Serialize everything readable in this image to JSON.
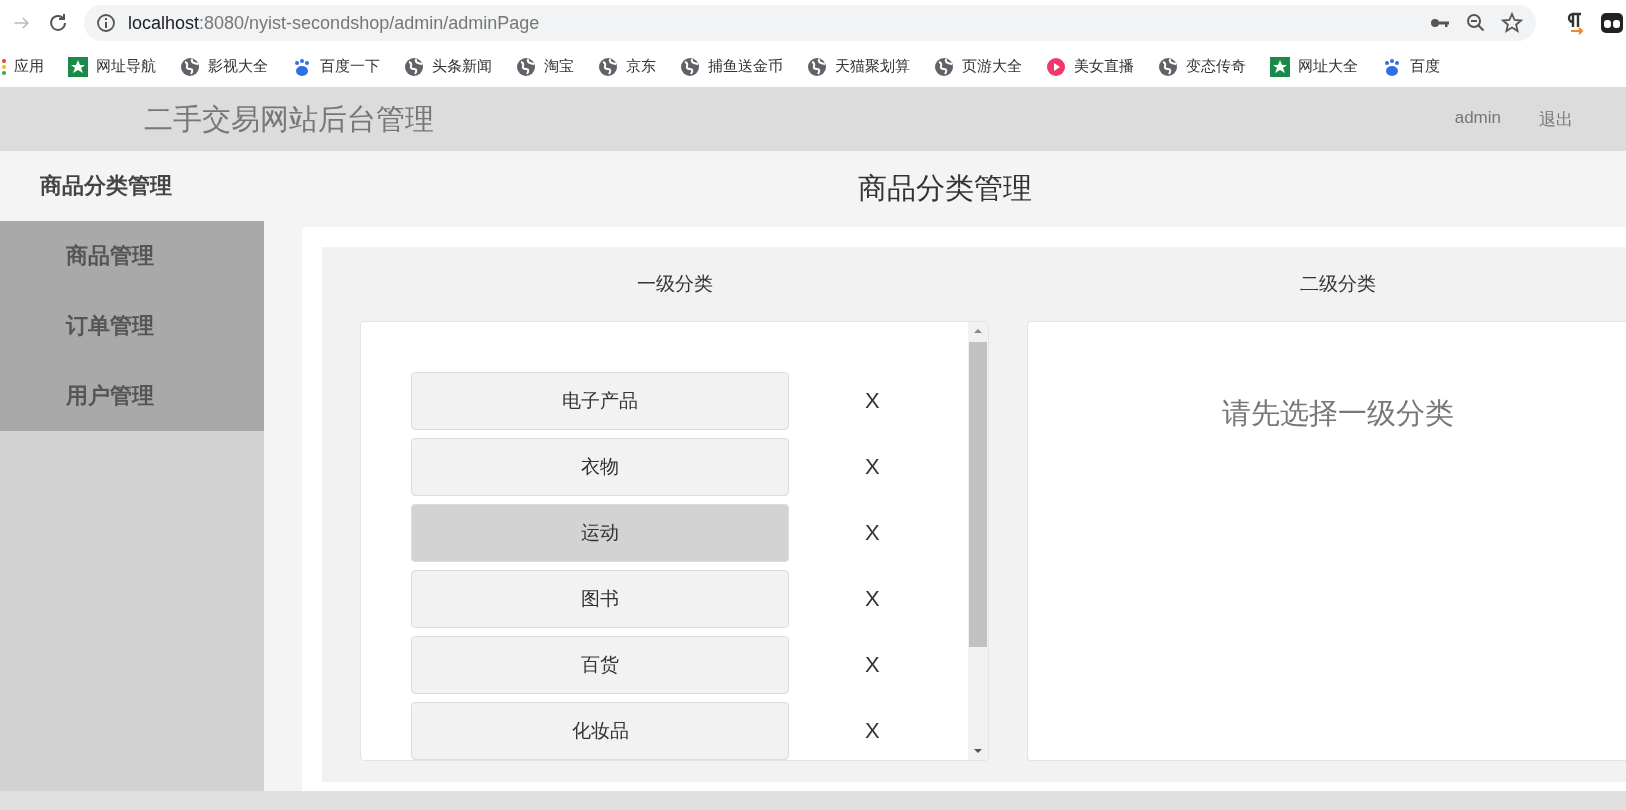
{
  "browser": {
    "url_host": "localhost",
    "url_path": ":8080/nyist-secondshop/admin/adminPage",
    "bookmarks": [
      {
        "kind": "apps",
        "label": "应用"
      },
      {
        "kind": "site",
        "label": "网址导航"
      },
      {
        "kind": "globe",
        "label": "影视大全"
      },
      {
        "kind": "paw",
        "label": "百度一下"
      },
      {
        "kind": "globe",
        "label": "头条新闻"
      },
      {
        "kind": "globe",
        "label": "淘宝"
      },
      {
        "kind": "globe",
        "label": "京东"
      },
      {
        "kind": "globe",
        "label": "捕鱼送金币"
      },
      {
        "kind": "globe",
        "label": "天猫聚划算"
      },
      {
        "kind": "globe",
        "label": "页游大全"
      },
      {
        "kind": "video",
        "label": "美女直播"
      },
      {
        "kind": "globe",
        "label": "变态传奇"
      },
      {
        "kind": "site",
        "label": "网址大全"
      },
      {
        "kind": "paw",
        "label": "百度"
      }
    ]
  },
  "header": {
    "title": "二手交易网站后台管理",
    "user": "admin",
    "logout": "退出"
  },
  "sidebar": {
    "items": [
      {
        "label": "商品分类管理",
        "selected": true
      },
      {
        "label": "商品管理",
        "selected": false
      },
      {
        "label": "订单管理",
        "selected": false
      },
      {
        "label": "用户管理",
        "selected": false
      }
    ]
  },
  "main": {
    "title": "商品分类管理",
    "level1": {
      "heading": "一级分类",
      "items": [
        {
          "label": "电子产品",
          "selected": false,
          "delete": "X"
        },
        {
          "label": "衣物",
          "selected": false,
          "delete": "X"
        },
        {
          "label": "运动",
          "selected": true,
          "delete": "X"
        },
        {
          "label": "图书",
          "selected": false,
          "delete": "X"
        },
        {
          "label": "百货",
          "selected": false,
          "delete": "X"
        },
        {
          "label": "化妆品",
          "selected": false,
          "delete": "X"
        }
      ]
    },
    "level2": {
      "heading": "二级分类",
      "message": "请先选择一级分类"
    }
  }
}
